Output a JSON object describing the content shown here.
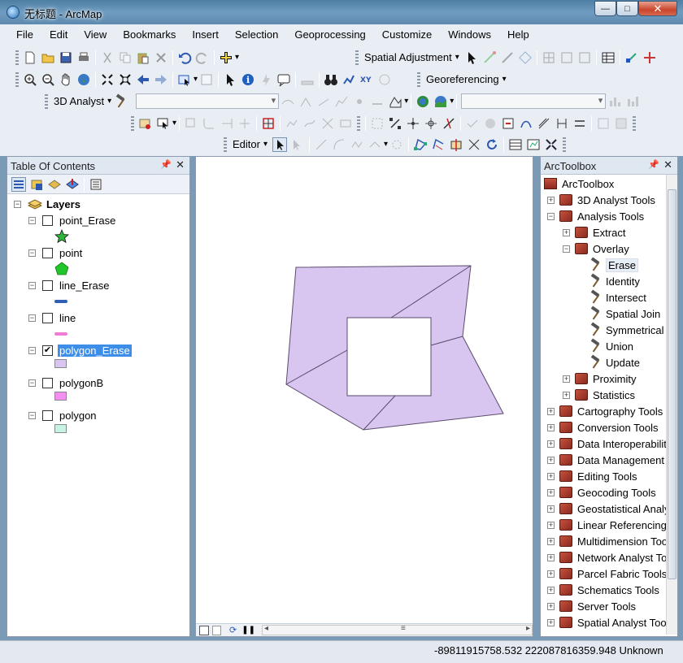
{
  "window": {
    "title": "无标题 - ArcMap",
    "min": "—",
    "max": "□",
    "close": "✕"
  },
  "menu": [
    "File",
    "Edit",
    "View",
    "Bookmarks",
    "Insert",
    "Selection",
    "Geoprocessing",
    "Customize",
    "Windows",
    "Help"
  ],
  "toolbars": {
    "spatial_adjustment": "Spatial Adjustment",
    "georeferencing": "Georeferencing",
    "analyst_3d": "3D Analyst",
    "editor": "Editor"
  },
  "toc": {
    "title": "Table Of Contents",
    "root": "Layers",
    "layers": [
      {
        "name": "point_Erase",
        "checked": false,
        "symbol": "star",
        "color": "#2fb53a"
      },
      {
        "name": "point",
        "checked": false,
        "symbol": "pentagon",
        "color": "#22c52a"
      },
      {
        "name": "line_Erase",
        "checked": false,
        "symbol": "line",
        "color": "#2e5fb5"
      },
      {
        "name": "line",
        "checked": false,
        "symbol": "line",
        "color": "#f07ad8"
      },
      {
        "name": "polygon_Erase",
        "checked": true,
        "selected": true,
        "symbol": "fill",
        "color": "#d8c6f0"
      },
      {
        "name": "polygonB",
        "checked": false,
        "symbol": "fill",
        "color": "#f28ff0"
      },
      {
        "name": "polygon",
        "checked": false,
        "symbol": "fill",
        "color": "#c9f2e6"
      }
    ]
  },
  "toolbox": {
    "title": "ArcToolbox",
    "root": "ArcToolbox",
    "items": [
      {
        "label": "3D Analyst Tools",
        "level": 1,
        "kind": "box",
        "exp": "+"
      },
      {
        "label": "Analysis Tools",
        "level": 1,
        "kind": "box",
        "exp": "−"
      },
      {
        "label": "Extract",
        "level": 2,
        "kind": "box",
        "exp": "+"
      },
      {
        "label": "Overlay",
        "level": 2,
        "kind": "box",
        "exp": "−"
      },
      {
        "label": "Erase",
        "level": 3,
        "kind": "tool",
        "selected": true
      },
      {
        "label": "Identity",
        "level": 3,
        "kind": "tool"
      },
      {
        "label": "Intersect",
        "level": 3,
        "kind": "tool"
      },
      {
        "label": "Spatial Join",
        "level": 3,
        "kind": "tool"
      },
      {
        "label": "Symmetrical Difference",
        "level": 3,
        "kind": "tool"
      },
      {
        "label": "Union",
        "level": 3,
        "kind": "tool"
      },
      {
        "label": "Update",
        "level": 3,
        "kind": "tool"
      },
      {
        "label": "Proximity",
        "level": 2,
        "kind": "box",
        "exp": "+"
      },
      {
        "label": "Statistics",
        "level": 2,
        "kind": "box",
        "exp": "+"
      },
      {
        "label": "Cartography Tools",
        "level": 1,
        "kind": "box",
        "exp": "+"
      },
      {
        "label": "Conversion Tools",
        "level": 1,
        "kind": "box",
        "exp": "+"
      },
      {
        "label": "Data Interoperability Tools",
        "level": 1,
        "kind": "box",
        "exp": "+"
      },
      {
        "label": "Data Management Tools",
        "level": 1,
        "kind": "box",
        "exp": "+"
      },
      {
        "label": "Editing Tools",
        "level": 1,
        "kind": "box",
        "exp": "+"
      },
      {
        "label": "Geocoding Tools",
        "level": 1,
        "kind": "box",
        "exp": "+"
      },
      {
        "label": "Geostatistical Analyst Tools",
        "level": 1,
        "kind": "box",
        "exp": "+"
      },
      {
        "label": "Linear Referencing Tools",
        "level": 1,
        "kind": "box",
        "exp": "+"
      },
      {
        "label": "Multidimension Tools",
        "level": 1,
        "kind": "box",
        "exp": "+"
      },
      {
        "label": "Network Analyst Tools",
        "level": 1,
        "kind": "box",
        "exp": "+"
      },
      {
        "label": "Parcel Fabric Tools",
        "level": 1,
        "kind": "box",
        "exp": "+"
      },
      {
        "label": "Schematics Tools",
        "level": 1,
        "kind": "box",
        "exp": "+"
      },
      {
        "label": "Server Tools",
        "level": 1,
        "kind": "box",
        "exp": "+"
      },
      {
        "label": "Spatial Analyst Tools",
        "level": 1,
        "kind": "box",
        "exp": "+"
      }
    ]
  },
  "map": {
    "fill": "#d8c6f0",
    "stroke": "#5a4a6a"
  },
  "status": {
    "coords": "-89811915758.532  222087816359.948 Unknown"
  }
}
